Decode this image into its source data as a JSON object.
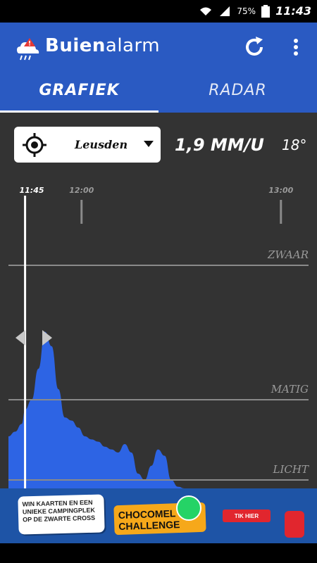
{
  "status": {
    "battery_percent": "75%",
    "time": "11:43"
  },
  "app": {
    "title_bold": "Buien",
    "title_light": "alarm"
  },
  "tabs": [
    {
      "label": "GRAFIEK"
    },
    {
      "label": "RADAR"
    }
  ],
  "location": {
    "name": "Leusden"
  },
  "readout": {
    "rate": "1,9 MM/U",
    "temperature": "18°"
  },
  "chart": {
    "time_labels": [
      "11:45",
      "12:00",
      "13:00"
    ],
    "intensity_labels": [
      "ZWAAR",
      "MATIG",
      "LICHT"
    ]
  },
  "chart_data": {
    "type": "area",
    "x": [
      "11:38",
      "11:40",
      "11:42",
      "11:43",
      "11:45",
      "11:47",
      "11:49",
      "11:51",
      "11:53",
      "11:55",
      "11:57",
      "11:59",
      "12:01",
      "12:03",
      "12:05",
      "12:07",
      "12:09",
      "12:11",
      "12:13",
      "12:15",
      "12:17",
      "12:19",
      "12:21",
      "12:23",
      "12:25",
      "12:27",
      "12:29",
      "12:31"
    ],
    "values": [
      0.35,
      0.4,
      0.5,
      0.75,
      1.0,
      1.7,
      3.2,
      2.5,
      1.2,
      0.6,
      0.55,
      0.45,
      0.35,
      0.32,
      0.3,
      0.26,
      0.24,
      0.22,
      0.28,
      0.22,
      0.12,
      0.1,
      0.15,
      0.24,
      0.2,
      0.1,
      0.02,
      0.0
    ],
    "ylabels": [
      "ZWAAR",
      "MATIG",
      "LICHT"
    ],
    "current_time": "11:43"
  },
  "ad": {
    "headline": "WIN KAARTEN EN EEN UNIEKE CAMPINGPLEK OP DE ZWARTE CROSS",
    "brand": "CHOCOMEL CHALLENGE",
    "cta": "TIK HIER"
  },
  "colors": {
    "appbar": "#2a5ac2",
    "background": "#333333",
    "rain": "#2d64e4"
  }
}
